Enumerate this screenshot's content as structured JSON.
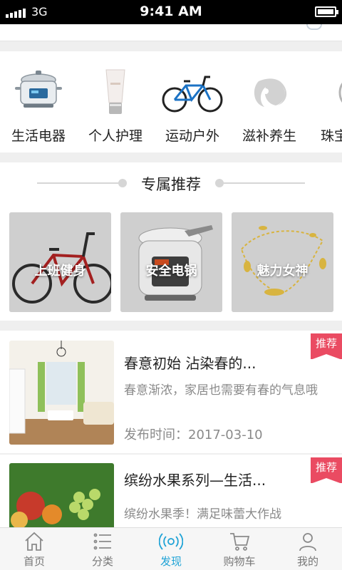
{
  "status_bar": {
    "carrier": "3G",
    "time": "9:41 AM"
  },
  "categories": [
    {
      "label": "生活电器",
      "icon": "electric-cooker-icon"
    },
    {
      "label": "个人护理",
      "icon": "cosmetic-tube-icon"
    },
    {
      "label": "运动户外",
      "icon": "bicycle-icon"
    },
    {
      "label": "滋补养生",
      "icon": "tonic-logo-icon"
    },
    {
      "label": "珠宝",
      "icon": "jewelry-icon"
    }
  ],
  "recommend": {
    "title": "专属推荐",
    "cards": [
      {
        "label": "上班健身"
      },
      {
        "label": "安全电锅"
      },
      {
        "label": "魅力女神"
      }
    ]
  },
  "articles": [
    {
      "title": "春意初始 沾染春的...",
      "desc": "春意渐浓，家居也需要有春的气息哦",
      "date": "发布时间：2017-03-10",
      "badge": "推荐"
    },
    {
      "title": "缤纷水果系列—生活...",
      "desc": "缤纷水果季！满足味蕾大作战",
      "badge": "推荐"
    }
  ],
  "tabs": [
    {
      "label": "首页",
      "icon": "home-icon"
    },
    {
      "label": "分类",
      "icon": "category-list-icon"
    },
    {
      "label": "发现",
      "icon": "discover-icon",
      "active": true
    },
    {
      "label": "购物车",
      "icon": "cart-icon"
    },
    {
      "label": "我的",
      "icon": "user-icon"
    }
  ],
  "colors": {
    "accent": "#1fa3d6",
    "badge": "#ea4b62"
  }
}
